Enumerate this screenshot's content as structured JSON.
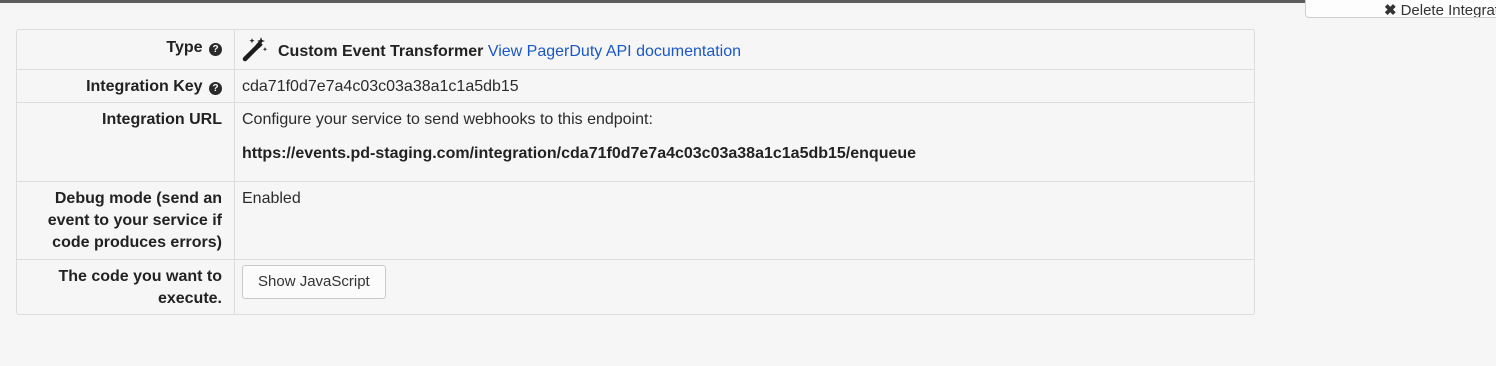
{
  "header": {
    "delete_button_label": "Delete Integration"
  },
  "details": {
    "type": {
      "label": "Type",
      "title": "Custom Event Transformer",
      "doc_link": "View PagerDuty API documentation"
    },
    "integration_key": {
      "label": "Integration Key",
      "value": "cda71f0d7e7a4c03c03a38a1c1a5db15"
    },
    "integration_url": {
      "label": "Integration URL",
      "description": "Configure your service to send webhooks to this endpoint:",
      "value": "https://events.pd-staging.com/integration/cda71f0d7e7a4c03c03a38a1c1a5db15/enqueue"
    },
    "debug_mode": {
      "label": "Debug mode (send an event to your service if code produces errors)",
      "value": "Enabled"
    },
    "code": {
      "label": "The code you want to execute.",
      "button_label": "Show JavaScript"
    }
  },
  "icons": {
    "help": "question-circle-icon",
    "type": "magic-wand-icon",
    "delete": "x-icon"
  },
  "colors": {
    "link": "#1a57c6",
    "background": "#f6f6f6",
    "border": "#dddddd"
  }
}
